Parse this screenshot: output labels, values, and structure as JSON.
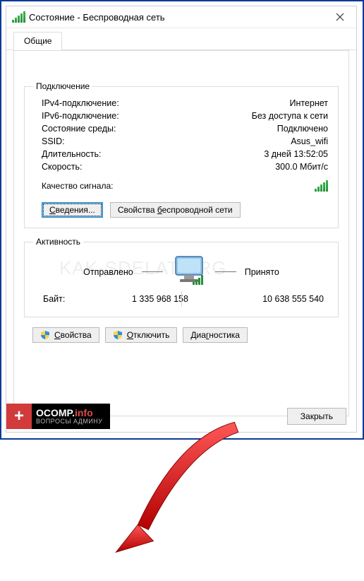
{
  "window": {
    "title": "Состояние - Беспроводная сеть"
  },
  "tab": {
    "general": "Общие"
  },
  "connection": {
    "legend": "Подключение",
    "rows": [
      {
        "k": "IPv4-подключение:",
        "v": "Интернет"
      },
      {
        "k": "IPv6-подключение:",
        "v": "Без доступа к сети"
      },
      {
        "k": "Состояние среды:",
        "v": "Подключено"
      },
      {
        "k": "SSID:",
        "v": "Asus_wifi"
      },
      {
        "k": "Длительность:",
        "v": "3 дней 13:52:05"
      },
      {
        "k": "Скорость:",
        "v": "300.0 Мбит/с"
      }
    ],
    "quality_label": "Качество сигнала:",
    "details_btn": "Сведения...",
    "wifi_props_btn": "Свойства беспроводной сети"
  },
  "activity": {
    "legend": "Активность",
    "sent": "Отправлено",
    "received": "Принято",
    "bytes_label": "Байт:",
    "bytes_sent": "1 335 968 158",
    "bytes_received": "10 638 555 540"
  },
  "buttons": {
    "properties": "Свойства",
    "disable": "Отключить",
    "diagnose": "Диагностика",
    "close": "Закрыть"
  },
  "watermark": "KAK-SDELAT.ORG",
  "badge": {
    "l1a": "OCOMP.",
    "l1b": "info",
    "l2": "ВОПРОСЫ АДМИНУ"
  }
}
